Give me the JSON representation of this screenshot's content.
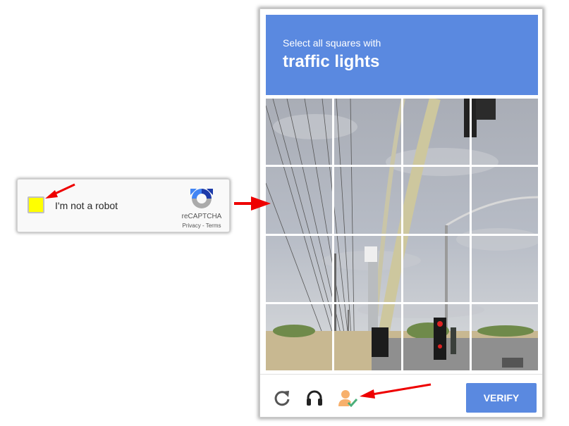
{
  "checkbox_widget": {
    "label": "I'm not a robot",
    "brand": "reCAPTCHA",
    "privacy_link": "Privacy",
    "separator": " - ",
    "terms_link": "Terms",
    "checkbox_color": "#ffff00"
  },
  "challenge": {
    "instruction": "Select all squares with",
    "target": "traffic lights",
    "header_color": "#5a89e0",
    "grid": {
      "rows": 4,
      "cols": 4
    },
    "footer": {
      "reload_icon": "reload-icon",
      "audio_icon": "headphones-icon",
      "info_icon": "person-check-icon",
      "verify_label": "VERIFY"
    }
  },
  "annotations": {
    "arrow_color": "#ee0000",
    "arrows": [
      "checkbox-arrow",
      "popup-arrow",
      "info-icon-arrow"
    ]
  }
}
